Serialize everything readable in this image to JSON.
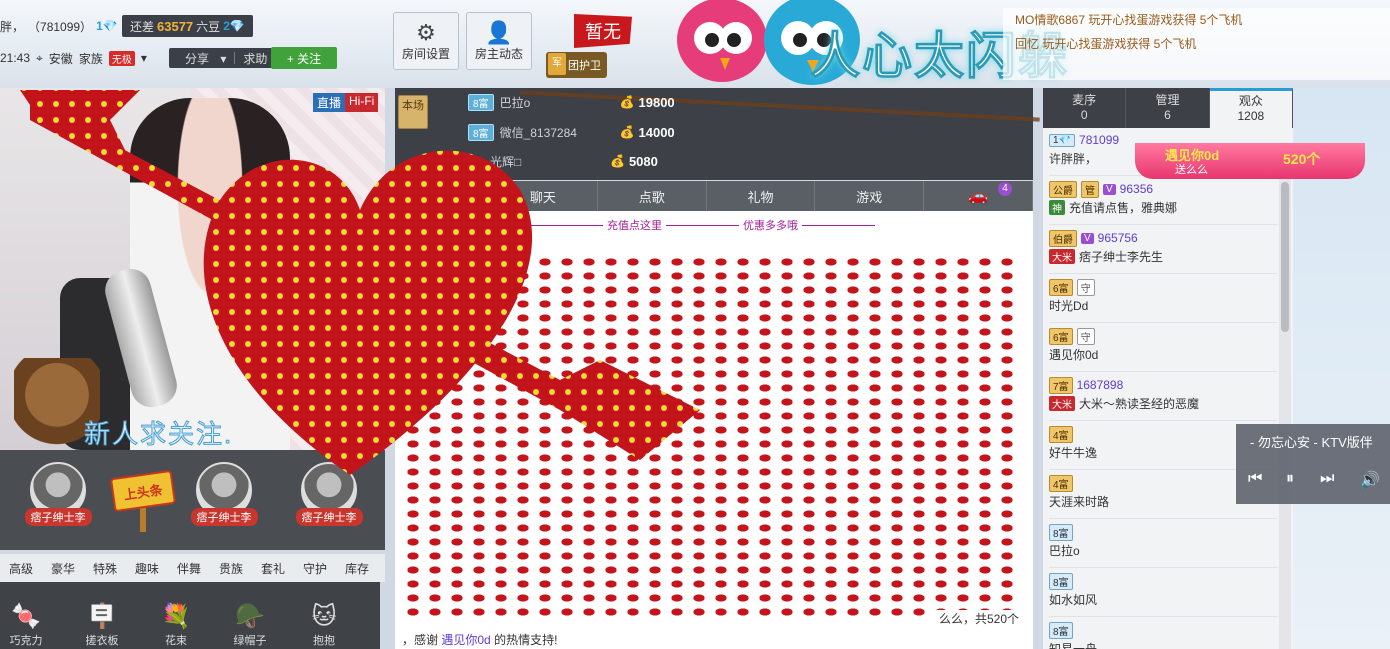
{
  "header": {
    "host_name_partial": "胖，",
    "host_id": "（781099）",
    "host_level": "1",
    "goal_prefix": "还差",
    "goal_number": "63577",
    "goal_suffix": "六豆",
    "goal_level": "2",
    "time": "21:43",
    "location": "安徽",
    "family_label": "家族",
    "family_badge": "无极",
    "share_label": "分享",
    "help_label": "求助",
    "follow_label": "+ 关注",
    "room_settings_label": "房间设置",
    "owner_news_label": "房主动态",
    "flag_label": "暂无",
    "guard_badge": "军",
    "guard_label": "团护卫",
    "banner_text": "人心太闪躲"
  },
  "ticker": [
    {
      "text": "MO情歌6867 玩开心找蛋游戏获得 5个飞机"
    },
    {
      "text": "回忆 玩开心找蛋游戏获得 5个飞机"
    }
  ],
  "video": {
    "live_label": "直播",
    "hifi_label": "Hi-Fi",
    "caption": "新人求关注."
  },
  "headline": {
    "sign_label": "上头条",
    "slots": [
      {
        "name": "痞子绅士李"
      },
      {
        "name": "痞子绅士李"
      },
      {
        "name": "痞子绅士李"
      }
    ]
  },
  "gift_tabs": [
    "高级",
    "豪华",
    "特殊",
    "趣味",
    "伴舞",
    "贵族",
    "套礼",
    "守护",
    "库存"
  ],
  "gifts": [
    {
      "icon": "🍬",
      "label": "巧克力"
    },
    {
      "icon": "🪧",
      "label": "搓衣板"
    },
    {
      "icon": "💐",
      "label": "花束"
    },
    {
      "icon": "🪖",
      "label": "绿帽子"
    },
    {
      "icon": "🐱",
      "label": "抱抱"
    }
  ],
  "rank": {
    "label": "本场",
    "rows": [
      {
        "level": "8富",
        "name": "巴拉o",
        "value": "19800"
      },
      {
        "level": "8富",
        "name": "微信_8137284",
        "value": "14000"
      },
      {
        "level": "",
        "name": "光辉□",
        "value": "5080"
      }
    ]
  },
  "center_tabs": [
    {
      "label": "聊天"
    },
    {
      "label": "点歌"
    },
    {
      "label": "礼物"
    },
    {
      "label": "游戏"
    },
    {
      "label": "",
      "badge": "4"
    }
  ],
  "promo": {
    "left": "充值点这里",
    "right": "优惠多多哦"
  },
  "chat": {
    "gift_line": "么么，共520个",
    "thanks_prefix": "，感谢",
    "thanks_user": "遇见你0d",
    "thanks_suffix": "的热情支持!"
  },
  "right_tabs": [
    {
      "label": "麦序",
      "count": "0"
    },
    {
      "label": "管理",
      "count": "6"
    },
    {
      "label": "观众",
      "count": "1208"
    }
  ],
  "love_banner": {
    "name": "遇见你0d",
    "sub": "送么么",
    "count": "520个"
  },
  "users": [
    {
      "badges": [
        {
          "t": "1💎",
          "c": "blue"
        }
      ],
      "id": "781099",
      "name": "许胖胖，",
      "title": "",
      "title_color": ""
    },
    {
      "badges": [
        {
          "t": "公爵",
          "c": "gold"
        },
        {
          "t": "管",
          "c": "gold"
        },
        {
          "t": "V",
          "c": "vip"
        }
      ],
      "id": "96356",
      "title": "神",
      "title_color": "#3a8a3a",
      "name": "充值请点售，雅典娜"
    },
    {
      "badges": [
        {
          "t": "伯爵",
          "c": "gold"
        },
        {
          "t": "V",
          "c": "vip"
        }
      ],
      "id": "965756",
      "title": "大米",
      "title_color": "#c8292f",
      "name": "痞子绅士李先生"
    },
    {
      "badges": [
        {
          "t": "6富",
          "c": "gold"
        },
        {
          "t": "守",
          "c": "gray"
        }
      ],
      "id": "",
      "title": "",
      "title_color": "",
      "name": "时光Dd"
    },
    {
      "badges": [
        {
          "t": "6富",
          "c": "gold"
        },
        {
          "t": "守",
          "c": "gray"
        }
      ],
      "id": "",
      "title": "",
      "title_color": "",
      "name": "遇见你0d"
    },
    {
      "badges": [
        {
          "t": "7富",
          "c": "gold"
        }
      ],
      "id": "1687898",
      "title": "大米",
      "title_color": "#c8292f",
      "name": "大米～熟读圣经的恶魔"
    },
    {
      "badges": [
        {
          "t": "4富",
          "c": "gold"
        }
      ],
      "id": "",
      "title": "",
      "title_color": "",
      "name": "好牛牛逸"
    },
    {
      "badges": [
        {
          "t": "4富",
          "c": "gold"
        }
      ],
      "id": "",
      "title": "",
      "title_color": "",
      "name": "天涯来时路"
    },
    {
      "badges": [
        {
          "t": "8富",
          "c": "blue"
        }
      ],
      "id": "",
      "title": "",
      "title_color": "",
      "name": "巴拉o"
    },
    {
      "badges": [
        {
          "t": "8富",
          "c": "blue"
        }
      ],
      "id": "",
      "title": "",
      "title_color": "",
      "name": "如水如风"
    },
    {
      "badges": [
        {
          "t": "8富",
          "c": "blue"
        }
      ],
      "id": "",
      "title": "",
      "title_color": "",
      "name": "知易一舟"
    }
  ],
  "music": {
    "title": "- 勿忘心安 - KTV版伴",
    "prev": "⏮",
    "pause": "⏸",
    "next": "⏭",
    "volume": "🔊"
  }
}
